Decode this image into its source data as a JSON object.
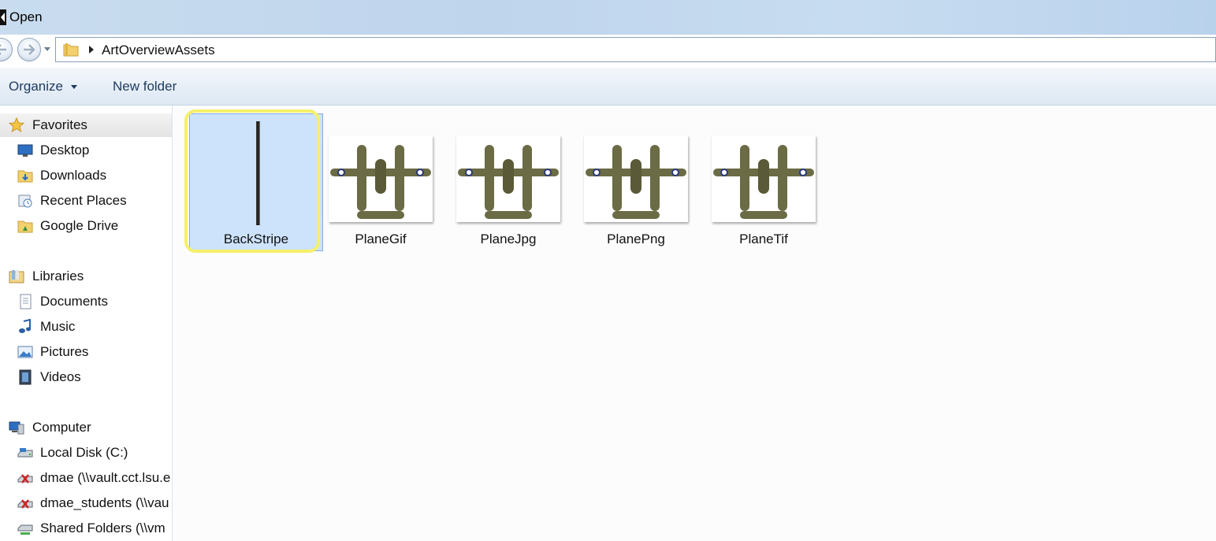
{
  "window": {
    "title": "Open"
  },
  "address": {
    "path": "ArtOverviewAssets"
  },
  "toolbar": {
    "organize_label": "Organize",
    "new_folder_label": "New folder"
  },
  "navigation": {
    "favorites": {
      "label": "Favorites",
      "items": [
        {
          "label": "Desktop",
          "icon": "desktop-icon"
        },
        {
          "label": "Downloads",
          "icon": "downloads-folder-icon"
        },
        {
          "label": "Recent Places",
          "icon": "recent-places-icon"
        },
        {
          "label": "Google Drive",
          "icon": "google-drive-folder-icon"
        }
      ]
    },
    "libraries": {
      "label": "Libraries",
      "items": [
        {
          "label": "Documents",
          "icon": "documents-icon"
        },
        {
          "label": "Music",
          "icon": "music-icon"
        },
        {
          "label": "Pictures",
          "icon": "pictures-icon"
        },
        {
          "label": "Videos",
          "icon": "videos-icon"
        }
      ]
    },
    "computer": {
      "label": "Computer",
      "items": [
        {
          "label": "Local Disk (C:)",
          "icon": "local-disk-icon"
        },
        {
          "label": "dmae (\\\\vault.cct.lsu.e",
          "icon": "disconnected-drive-icon"
        },
        {
          "label": "dmae_students (\\\\vau",
          "icon": "disconnected-drive-icon"
        },
        {
          "label": "Shared Folders (\\\\vm",
          "icon": "network-drive-icon"
        }
      ]
    }
  },
  "files": [
    {
      "name": "BackStripe",
      "thumbnail": "stripe",
      "selected": true
    },
    {
      "name": "PlaneGif",
      "thumbnail": "plane",
      "selected": false
    },
    {
      "name": "PlaneJpg",
      "thumbnail": "plane",
      "selected": false
    },
    {
      "name": "PlanePng",
      "thumbnail": "plane",
      "selected": false
    },
    {
      "name": "PlaneTif",
      "thumbnail": "plane",
      "selected": false
    }
  ],
  "colors": {
    "selection": "#cde3fb",
    "highlight_ring": "#f5f06a",
    "toolbar_text": "#1e3a5f"
  }
}
